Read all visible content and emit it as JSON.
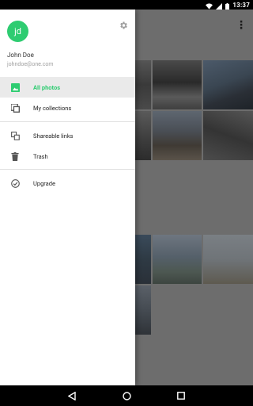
{
  "status_bar": {
    "time": "13:37"
  },
  "drawer": {
    "avatar_initials": "jd",
    "user_name": "John Doe",
    "user_email": "johndoe@one.com",
    "items": [
      {
        "label": "All photos",
        "icon": "photo-icon",
        "active": true
      },
      {
        "label": "My collections",
        "icon": "collections-icon",
        "active": false
      },
      {
        "label": "Shareable links",
        "icon": "copy-link-icon",
        "active": false
      },
      {
        "label": "Trash",
        "icon": "trash-icon",
        "active": false
      },
      {
        "label": "Upgrade",
        "icon": "check-circle-icon",
        "active": false
      }
    ]
  },
  "colors": {
    "accent": "#2ecc71",
    "scrim": "#6d6d6d",
    "drawer_bg": "#ffffff",
    "active_row_bg": "#eaeaea"
  }
}
